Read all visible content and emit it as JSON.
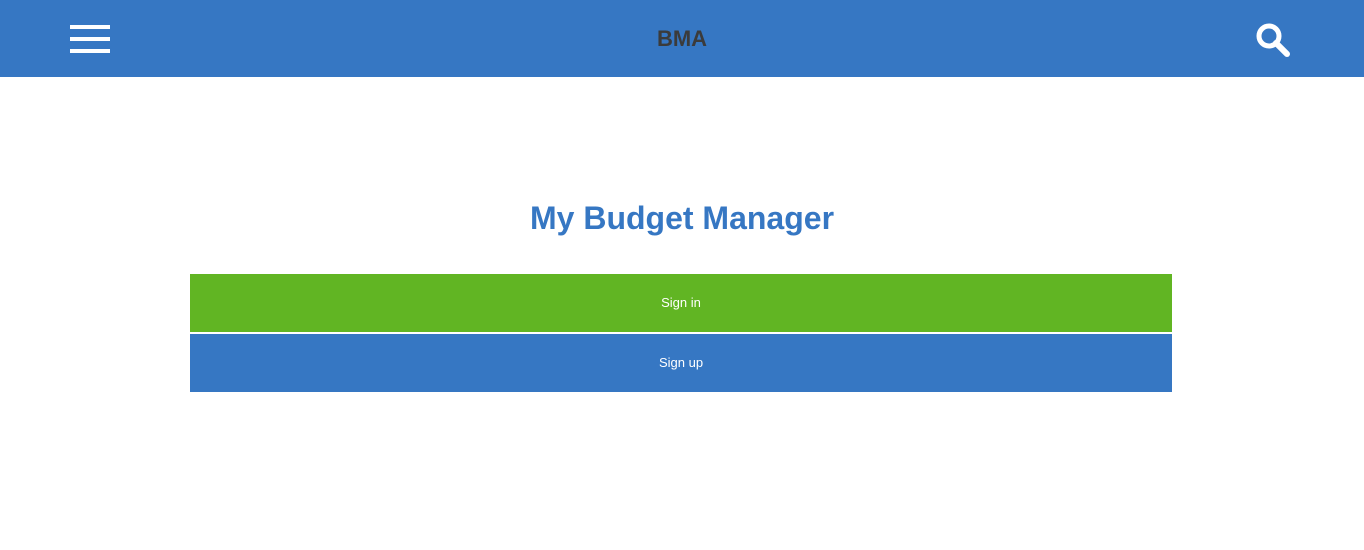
{
  "header": {
    "brand": "BMA",
    "menu_icon": "hamburger-menu-icon",
    "search_icon": "search-icon"
  },
  "main": {
    "title": "My Budget Manager",
    "sign_in_label": "Sign in",
    "sign_up_label": "Sign up"
  },
  "colors": {
    "header_bg": "#3677c3",
    "brand_text": "#3b3b3b",
    "title_text": "#3677c3",
    "sign_in_bg": "#61b523",
    "sign_up_bg": "#3677c3"
  }
}
